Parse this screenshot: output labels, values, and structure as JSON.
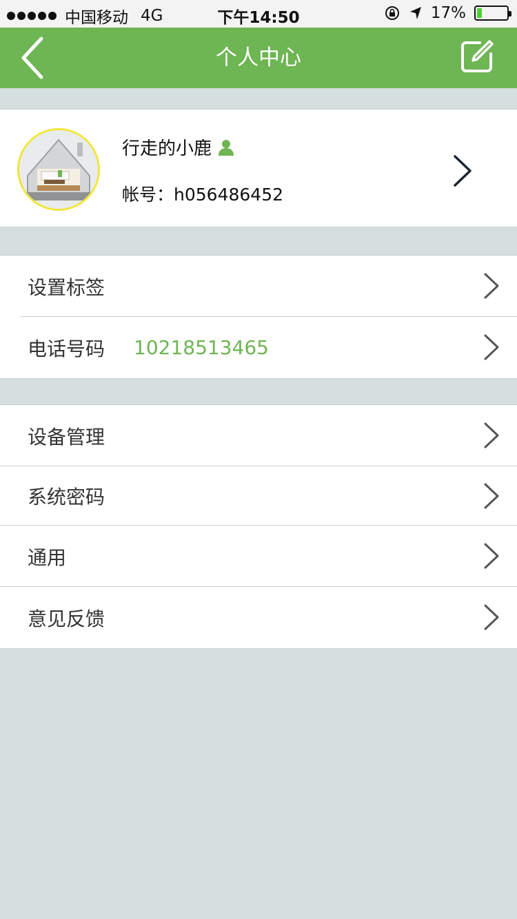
{
  "status_bar": {
    "carrier": "中国移动",
    "network": "4G",
    "time": "下午14:50",
    "battery_percent": "17%",
    "battery_level": 0.17,
    "icons": [
      "signal-dots-icon",
      "rotation-lock-icon",
      "location-arrow-icon",
      "battery-icon"
    ]
  },
  "nav": {
    "title": "个人中心",
    "back_icon": "chevron-left-icon",
    "edit_icon": "edit-icon"
  },
  "colors": {
    "accent": "#6eb553",
    "background": "#d6dfe0",
    "avatar_border": "#f1e63a"
  },
  "profile": {
    "name": "行走的小鹿",
    "account_label": "帐号：",
    "account_id": "h056486452",
    "avatar_icon": "house-avatar-image",
    "user_icon": "user-icon"
  },
  "group1": [
    {
      "label": "设置标签",
      "value": ""
    },
    {
      "label": "电话号码",
      "value": "10218513465"
    }
  ],
  "group2": [
    {
      "label": "设备管理"
    },
    {
      "label": "系统密码"
    },
    {
      "label": "通用"
    },
    {
      "label": "意见反馈"
    }
  ]
}
